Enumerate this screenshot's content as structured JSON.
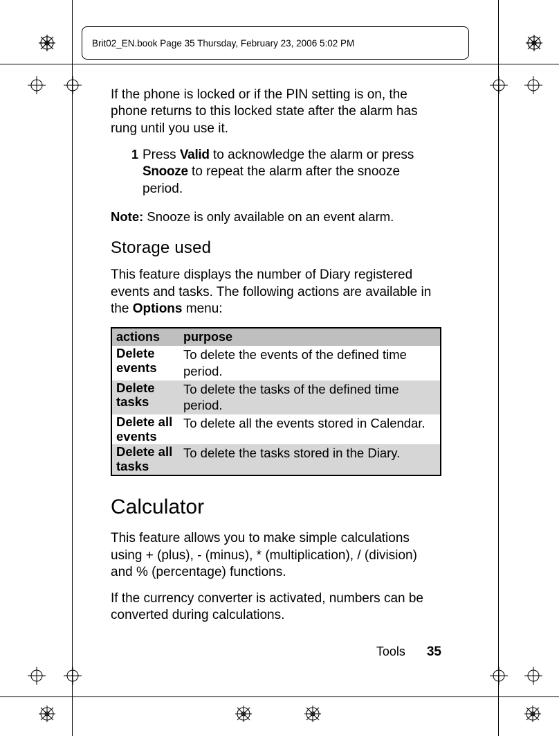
{
  "header": {
    "text": "Brit02_EN.book  Page 35  Thursday, February 23, 2006  5:02 PM"
  },
  "body": {
    "intro": "If the phone is locked or if the PIN setting is on, the phone returns to this locked state after the alarm has rung until you use it.",
    "step_num": "1",
    "step_pre": "Press ",
    "step_valid": "Valid",
    "step_mid": " to acknowledge the alarm or press ",
    "step_snooze": "Snooze",
    "step_post": " to repeat the alarm after the snooze period.",
    "note_label": "Note:",
    "note_text": " Snooze is only available on an event alarm.",
    "h_storage": "Storage used",
    "storage_pre": "This feature displays the number of Diary registered events and tasks. The following actions are available in the ",
    "storage_bold": "Options",
    "storage_post": " menu:",
    "table": {
      "h1": "actions",
      "h2": "purpose",
      "rows": [
        {
          "a": "Delete events",
          "p": "To delete the events of the defined time period."
        },
        {
          "a": "Delete tasks",
          "p": "To delete the tasks of the defined time period."
        },
        {
          "a": "Delete all events",
          "p": "To delete all the events stored in Calendar."
        },
        {
          "a": "Delete all tasks",
          "p": "To delete the tasks stored in the Diary."
        }
      ]
    },
    "h_calc": "Calculator",
    "calc_p1": "This feature allows you to make simple calculations using + (plus), - (minus), * (multiplication), / (division) and % (percentage) functions.",
    "calc_p2": "If the currency converter is activated, numbers can be converted during calculations."
  },
  "footer": {
    "section": "Tools",
    "page": "35"
  }
}
